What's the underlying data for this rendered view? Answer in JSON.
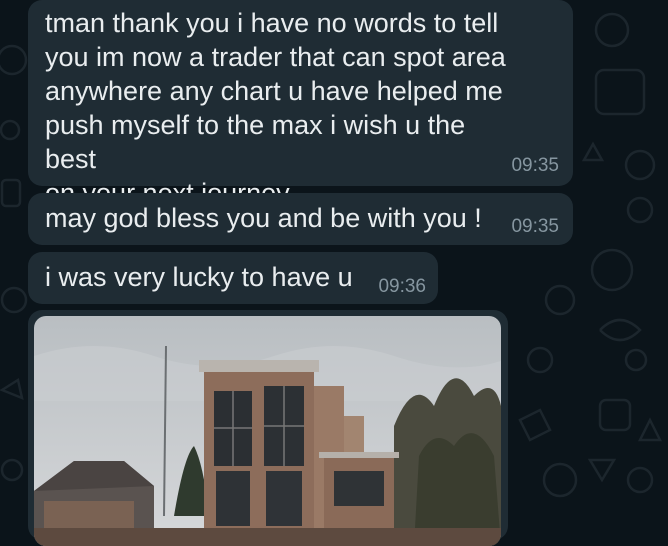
{
  "messages": [
    {
      "text": "tman thank you i have no words to tell\nyou im now  a trader that can spot area\nanywhere any chart u have helped me\npush myself to the max i wish u the best\non your next journey",
      "time": "09:35"
    },
    {
      "text": "may god bless you and be with you !",
      "time": "09:35"
    },
    {
      "text": "i was very lucky to have u",
      "time": "09:36"
    }
  ],
  "image_message": {
    "alt": "house-photo"
  },
  "colors": {
    "background": "#0b141a",
    "bubble": "#1f2c34",
    "text": "#e9edef",
    "time": "#8696a0"
  }
}
